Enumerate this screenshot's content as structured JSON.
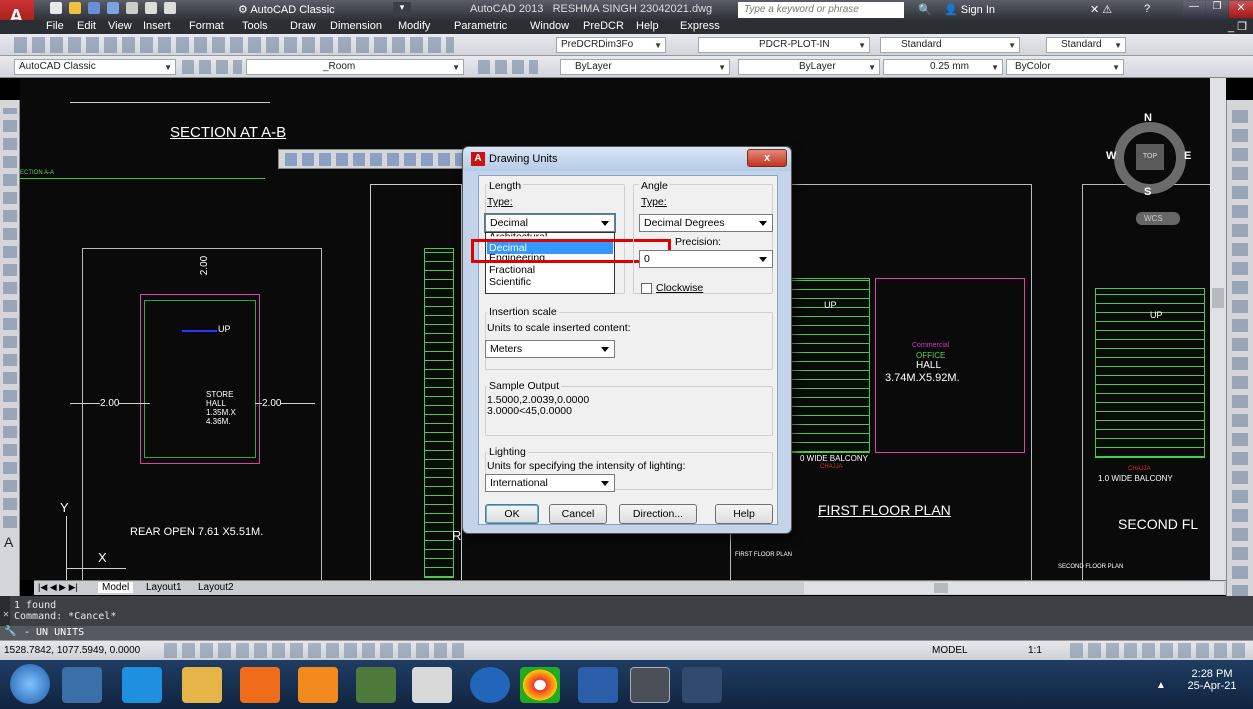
{
  "titlebar": {
    "workspace": "AutoCAD Classic",
    "app_title": "AutoCAD 2013",
    "file_title": "RESHMA SINGH 23042021.dwg",
    "search_placeholder": "Type a keyword or phrase",
    "signin": "Sign In"
  },
  "menu": [
    "File",
    "Edit",
    "View",
    "Insert",
    "Format",
    "Tools",
    "Draw",
    "Dimension",
    "Modify",
    "Parametric",
    "Window",
    "PreDCR",
    "Help",
    "Express"
  ],
  "toolbar1": {
    "dimstyle": "PreDCRDim3Fo",
    "plotstyle": "PDCR-PLOT-IN",
    "textstyle": "Standard",
    "tablestyle": "Standard"
  },
  "toolbar2": {
    "workspace": "AutoCAD Classic",
    "layer": "_Room",
    "color": "ByLayer",
    "linetype": "ByLayer",
    "lineweight": "0.25 mm",
    "plotstyle": "ByColor"
  },
  "drawing": {
    "section_title": "SECTION AT A-B",
    "section_small": "ECTION A-A",
    "dim_200_vert": "2.00",
    "dim_200_left": "2.00",
    "dim_200_right": "2.00",
    "up_label": "UP",
    "store_hall": [
      "STORE",
      "HALL",
      "1.35M.X",
      "4.36M."
    ],
    "rear_open": "REAR OPEN 7.61 X5.51M.",
    "first_floor": "FIRST FLOOR PLAN",
    "first_floor_small": "FIRST FLOOR PLAN",
    "second_floor": "SECOND FL",
    "second_floor_small": "SECOND FLOOR PLAN",
    "hall_label": "HALL",
    "hall_dim": "3.74M.X5.92M.",
    "commercial": "Commercial",
    "office": "OFFICE",
    "balcony1": "0 WIDE BALCONY",
    "chajja1": "CHAJJA",
    "balcony2": "1.0 WIDE BALCONY",
    "chajja2": "CHAJJA",
    "axis_y": "Y",
    "axis_x": "X",
    "rear_overlap": "R"
  },
  "viewcube": {
    "n": "N",
    "s": "S",
    "e": "E",
    "w": "W",
    "top": "TOP",
    "wcs": "WCS"
  },
  "dialog": {
    "title": "Drawing Units",
    "length_group": "Length",
    "length_type_label": "Type:",
    "length_type_value": "Decimal",
    "length_options": [
      "Architectural",
      "Decimal",
      "Engineering",
      "Fractional",
      "Scientific"
    ],
    "angle_group": "Angle",
    "angle_type_label": "Type:",
    "angle_type_value": "Decimal Degrees",
    "precision_label": "Precision:",
    "precision_value": "0",
    "clockwise": "Clockwise",
    "insertion_group": "Insertion scale",
    "insertion_desc": "Units to scale inserted content:",
    "insertion_value": "Meters",
    "sample_group": "Sample Output",
    "sample_line1": "1.5000,2.0039,0.0000",
    "sample_line2": "3.0000<45,0.0000",
    "lighting_group": "Lighting",
    "lighting_desc": "Units for specifying the intensity of lighting:",
    "lighting_value": "International",
    "ok": "OK",
    "cancel": "Cancel",
    "direction": "Direction...",
    "help": "Help"
  },
  "tabs": [
    "Model",
    "Layout1",
    "Layout2"
  ],
  "command": {
    "line1": "1 found",
    "line2": "Command: *Cancel*",
    "prompt": "- UN UNITS"
  },
  "status": {
    "coords": "1528.7842, 1077.5949, 0.0000",
    "model": "MODEL",
    "scale": "1:1"
  },
  "taskbar": {
    "time": "2:28 PM",
    "date": "25-Apr-21"
  }
}
